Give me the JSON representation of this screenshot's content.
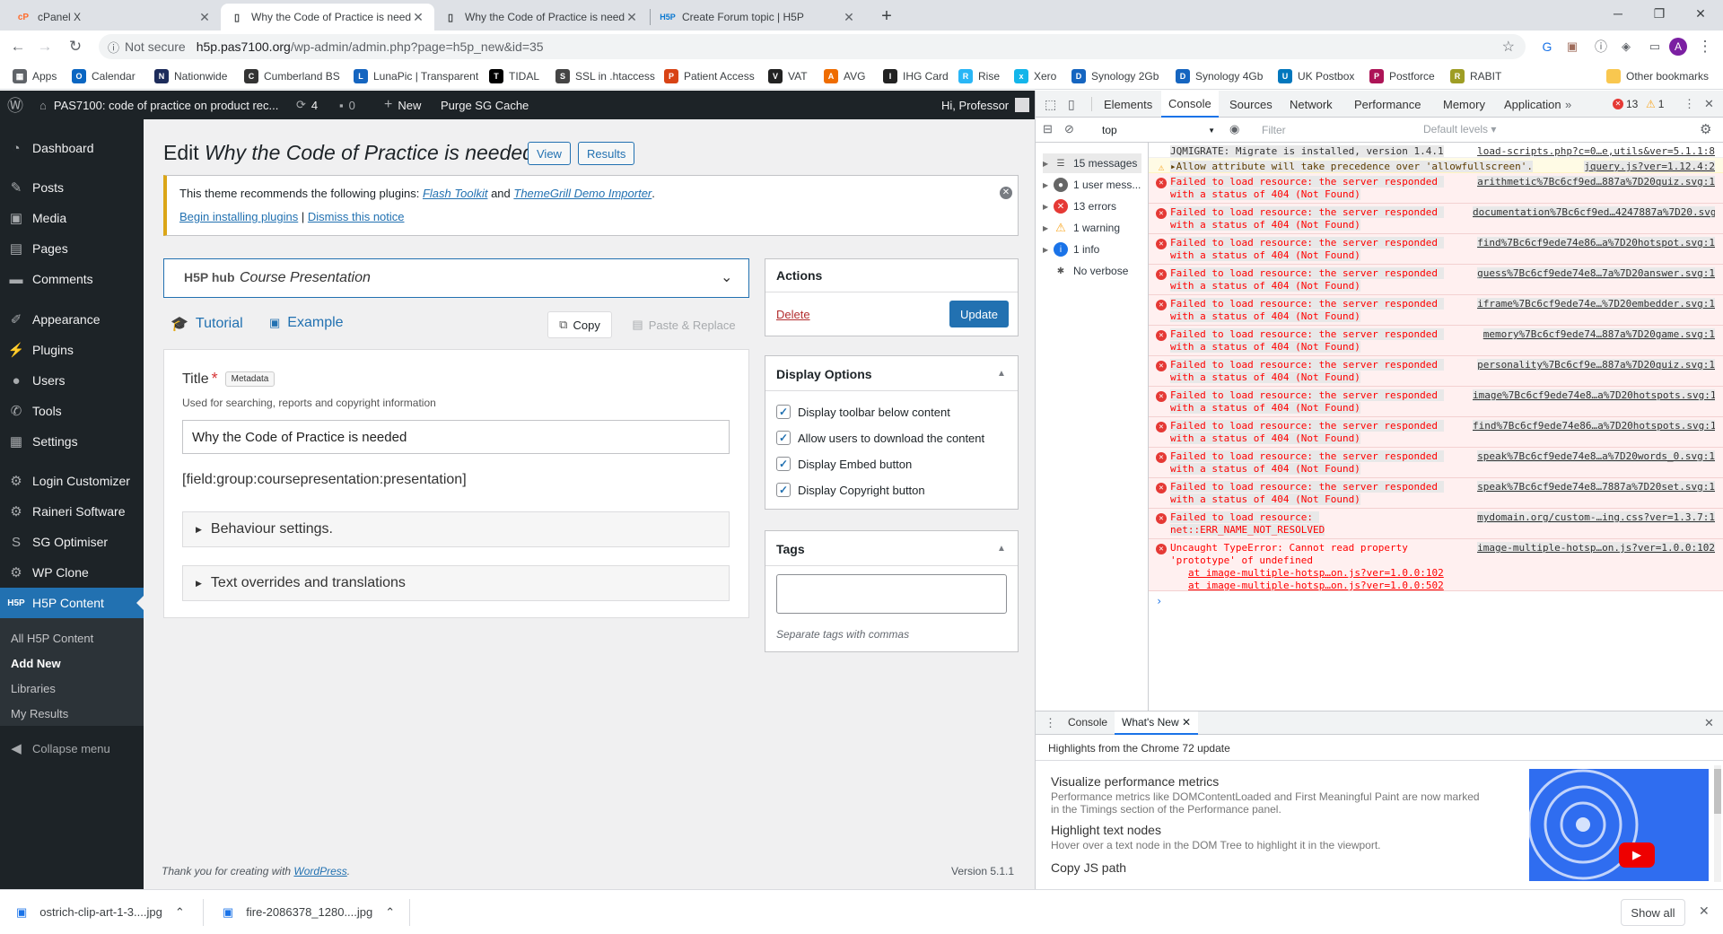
{
  "browser": {
    "tabs": [
      {
        "title": "cPanel X",
        "favicon": "cpanel-icon"
      },
      {
        "title": "Why the Code of Practice is need",
        "favicon": "page-icon"
      },
      {
        "title": "Why the Code of Practice is need",
        "favicon": "page-icon"
      },
      {
        "title": "Create Forum topic | H5P",
        "favicon": "h5p-icon"
      }
    ],
    "not_secure": "Not secure",
    "url_host": "h5p.pas7100.org",
    "url_path": "/wp-admin/admin.php?page=h5p_new&id=35",
    "bookmarks": [
      "Apps",
      "Calendar",
      "Nationwide",
      "Cumberland BS",
      "LunaPic | Transparent",
      "TIDAL",
      "SSL in .htaccess",
      "Patient Access",
      "VAT",
      "AVG",
      "IHG Card",
      "Rise",
      "Xero",
      "Synology 2Gb",
      "Synology 4Gb",
      "UK Postbox",
      "Postforce",
      "RABIT"
    ],
    "other_bookmarks": "Other bookmarks"
  },
  "wp_bar": {
    "site": "PAS7100: code of practice on product rec...",
    "updates": "4",
    "comments": "0",
    "new": "New",
    "purge": "Purge SG Cache",
    "greeting": "Hi, Professor"
  },
  "sidebar": {
    "items": [
      "Dashboard",
      "Posts",
      "Media",
      "Pages",
      "Comments",
      "Appearance",
      "Plugins",
      "Users",
      "Tools",
      "Settings",
      "Login Customizer",
      "Raineri Software",
      "SG Optimiser",
      "WP Clone",
      "H5P Content"
    ],
    "subitems": [
      "All H5P Content",
      "Add New",
      "Libraries",
      "My Results"
    ],
    "collapse": "Collapse menu"
  },
  "main": {
    "title_prefix": "Edit ",
    "title_italic": "Why the Code of Practice is needed",
    "view_btn": "View",
    "results_btn": "Results",
    "notice": {
      "text1": "This theme recommends the following plugins: ",
      "plugin1": "Flash Toolkit",
      "and": " and ",
      "plugin2": "ThemeGrill Demo Importer",
      "period": ".",
      "begin": "Begin installing plugins",
      "sep": " | ",
      "dismiss": "Dismiss this notice"
    },
    "hub_logo": "H5P hub",
    "content_type": "Course Presentation",
    "tutorial": "Tutorial",
    "example": "Example",
    "copy": "Copy",
    "paste": "Paste & Replace",
    "title_label": "Title",
    "required": "*",
    "metadata": "Metadata",
    "title_desc": "Used for searching, reports and copyright information",
    "title_value": "Why the Code of Practice is needed",
    "field_placeholder": "[field:group:coursepresentation:presentation]",
    "behaviour": "Behaviour settings.",
    "overrides": "Text overrides and translations",
    "footer_thanks": "Thank you for creating with ",
    "footer_link": "WordPress",
    "footer_period": ".",
    "version": "Version 5.1.1"
  },
  "actions": {
    "heading": "Actions",
    "delete": "Delete",
    "update": "Update"
  },
  "display_options": {
    "heading": "Display Options",
    "options": [
      "Display toolbar below content",
      "Allow users to download the content",
      "Display Embed button",
      "Display Copyright button"
    ]
  },
  "tags": {
    "heading": "Tags",
    "hint": "Separate tags with commas"
  },
  "devtools": {
    "tabs": [
      "Elements",
      "Console",
      "Sources",
      "Network",
      "Performance",
      "Memory",
      "Application"
    ],
    "errors_count": "13",
    "warnings_count": "1",
    "context": "top",
    "filter": "Filter",
    "levels": "Default levels",
    "groups": [
      "15 messages",
      "1 user mess...",
      "13 errors",
      "1 warning",
      "1 info",
      "No verbose"
    ],
    "logs": [
      {
        "type": "info",
        "msg": "JQMIGRATE: Migrate is installed, version 1.4.1",
        "src": "load-scripts.php?c=0…e,utils&ver=5.1.1:8"
      },
      {
        "type": "warn",
        "msg": "▸Allow attribute will take precedence over 'allowfullscreen'.",
        "src": "jquery.js?ver=1.12.4:2"
      },
      {
        "type": "error",
        "msg": "Failed to load resource: the server responded with a status of 404 (Not Found)",
        "src": "arithmetic%7Bc6cf9ed…887a%7D20quiz.svg:1"
      },
      {
        "type": "error",
        "msg": "Failed to load resource: the server responded with a status of 404 (Not Found)",
        "src": "documentation%7Bc6cf9ed…4247887a%7D20.svg:1"
      },
      {
        "type": "error",
        "msg": "Failed to load resource: the server responded with a status of 404 (Not Found)",
        "src": "find%7Bc6cf9ede74e86…a%7D20hotspot.svg:1"
      },
      {
        "type": "error",
        "msg": "Failed to load resource: the server responded with a status of 404 (Not Found)",
        "src": "guess%7Bc6cf9ede74e8…7a%7D20answer.svg:1"
      },
      {
        "type": "error",
        "msg": "Failed to load resource: the server responded with a status of 404 (Not Found)",
        "src": "iframe%7Bc6cf9ede74e…%7D20embedder.svg:1"
      },
      {
        "type": "error",
        "msg": "Failed to load resource: the server responded with a status of 404 (Not Found)",
        "src": "memory%7Bc6cf9ede74…887a%7D20game.svg:1"
      },
      {
        "type": "error",
        "msg": "Failed to load resource: the server responded with a status of 404 (Not Found)",
        "src": "personality%7Bc6cf9e…887a%7D20quiz.svg:1"
      },
      {
        "type": "error",
        "msg": "Failed to load resource: the server responded with a status of 404 (Not Found)",
        "src": "image%7Bc6cf9ede74e8…a%7D20hotspots.svg:1"
      },
      {
        "type": "error",
        "msg": "Failed to load resource: the server responded with a status of 404 (Not Found)",
        "src": "find%7Bc6cf9ede74e86…a%7D20hotspots.svg:1"
      },
      {
        "type": "error",
        "msg": "Failed to load resource: the server responded with a status of 404 (Not Found)",
        "src": "speak%7Bc6cf9ede74e8…a%7D20words_0.svg:1"
      },
      {
        "type": "error",
        "msg": "Failed to load resource: the server responded with a status of 404 (Not Found)",
        "src": "speak%7Bc6cf9ede74e8…7887a%7D20set.svg:1"
      },
      {
        "type": "error",
        "msg": "Failed to load resource: net::ERR_NAME_NOT_RESOLVED",
        "src": "mydomain.org/custom-…ing.css?ver=1.3.7:1"
      },
      {
        "type": "error",
        "msg": "Uncaught TypeError: Cannot read property 'prototype' of undefined",
        "src": "image-multiple-hotsp…on.js?ver=1.0.0:102",
        "stack": [
          "at image-multiple-hotsp…on.js?ver=1.0.0:102",
          "at image-multiple-hotsp…on.js?ver=1.0.0:502"
        ]
      }
    ],
    "drawer_tabs": [
      "Console",
      "What's New"
    ],
    "drawer_heading": "Highlights from the Chrome 72 update",
    "news": [
      {
        "title": "Visualize performance metrics",
        "desc": "Performance metrics like DOMContentLoaded and First Meaningful Paint are now marked in the Timings section of the Performance panel."
      },
      {
        "title": "Highlight text nodes",
        "desc": "Hover over a text node in the DOM Tree to highlight it in the viewport."
      },
      {
        "title": "Copy JS path",
        "desc": ""
      }
    ]
  },
  "downloads": {
    "files": [
      "ostrich-clip-art-1-3....jpg",
      "fire-2086378_1280....jpg"
    ],
    "show_all": "Show all"
  },
  "colors": {
    "wp_blue": "#2271b1",
    "wp_dark": "#1d2327",
    "error_red": "#e53935"
  }
}
